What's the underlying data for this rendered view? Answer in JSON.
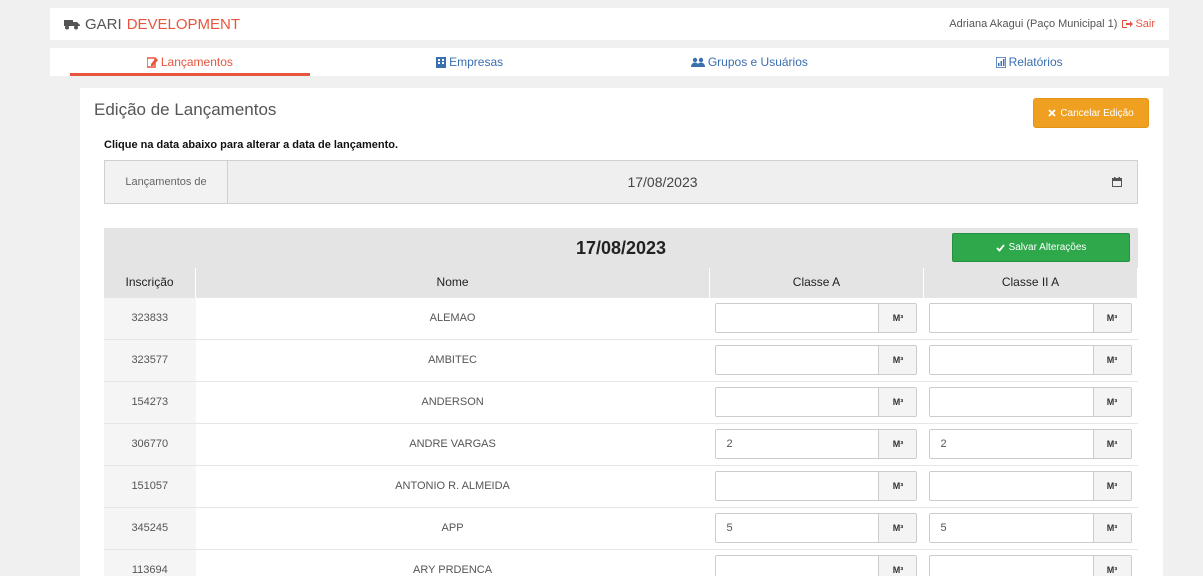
{
  "header": {
    "brand_first": "GARI",
    "brand_second": "DEVELOPMENT",
    "user": "Adriana Akagui (Paço Municipal 1)",
    "logout": "Sair"
  },
  "nav": {
    "items": [
      {
        "label": "Lançamentos",
        "icon": "edit-icon"
      },
      {
        "label": "Empresas",
        "icon": "building-icon"
      },
      {
        "label": "Grupos e Usuários",
        "icon": "users-icon"
      },
      {
        "label": "Relatórios",
        "icon": "report-icon"
      }
    ],
    "active": "Lançamentos"
  },
  "page": {
    "title": "Edição de Lançamentos",
    "cancel_label": "Cancelar Edição",
    "instruction": "Clique na data abaixo para alterar a data de lançamento."
  },
  "date_picker": {
    "addon": "Lançamentos de",
    "value": "17/08/2023"
  },
  "table": {
    "date": "17/08/2023",
    "save_label": "Salvar Alterações",
    "columns": [
      "Inscrição",
      "Nome",
      "Classe A",
      "Classe II A"
    ],
    "unit": "M³",
    "rows": [
      {
        "inscricao": "323833",
        "nome": "ALEMAO",
        "classe_a": "",
        "classe_ii_a": ""
      },
      {
        "inscricao": "323577",
        "nome": "AMBITEC",
        "classe_a": "",
        "classe_ii_a": ""
      },
      {
        "inscricao": "154273",
        "nome": "ANDERSON",
        "classe_a": "",
        "classe_ii_a": ""
      },
      {
        "inscricao": "306770",
        "nome": "ANDRE VARGAS",
        "classe_a": "2",
        "classe_ii_a": "2"
      },
      {
        "inscricao": "151057",
        "nome": "ANTONIO R. ALMEIDA",
        "classe_a": "",
        "classe_ii_a": ""
      },
      {
        "inscricao": "345245",
        "nome": "APP",
        "classe_a": "5",
        "classe_ii_a": "5"
      },
      {
        "inscricao": "113694",
        "nome": "ARY PRDENCA",
        "classe_a": "",
        "classe_ii_a": ""
      }
    ]
  },
  "colors": {
    "accent": "#e8553e",
    "link": "#3a6fb0",
    "cancel": "#f0a020",
    "save": "#2ea84a"
  }
}
